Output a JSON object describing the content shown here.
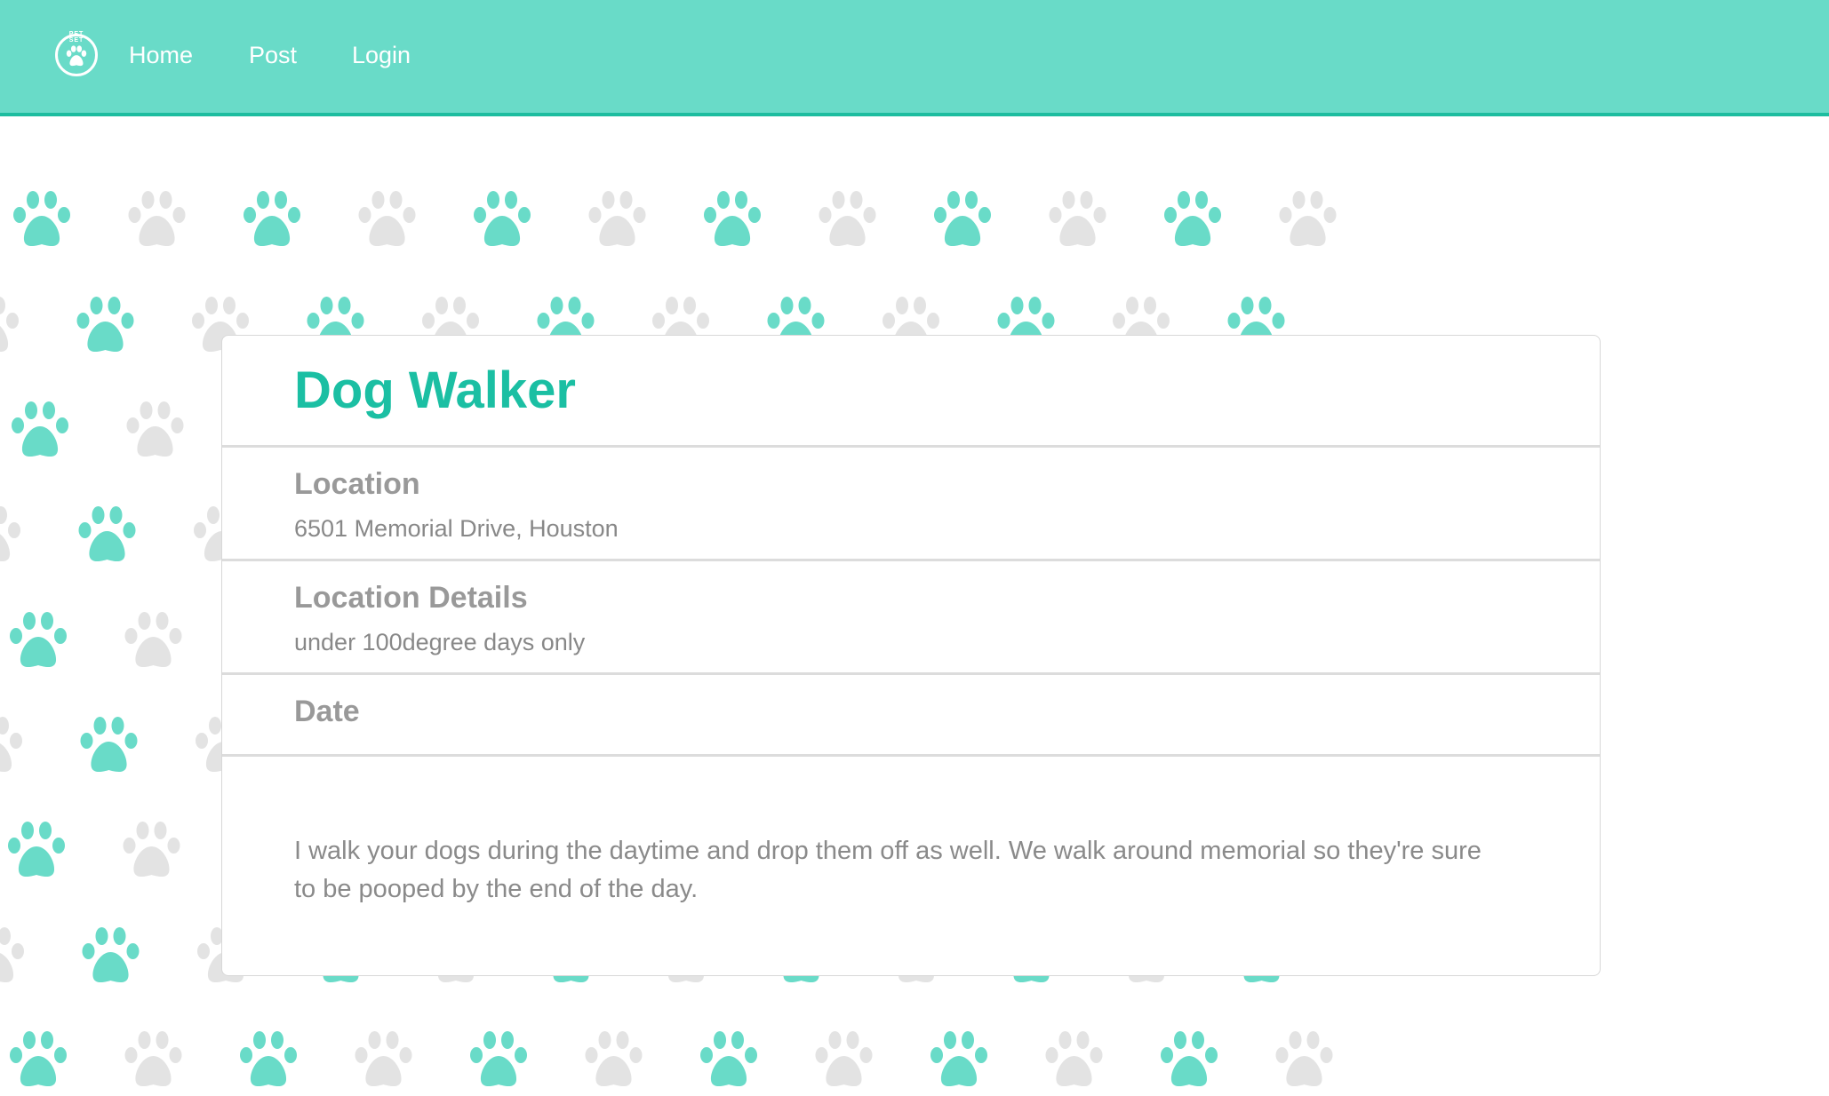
{
  "nav": {
    "logo_text": "PET SET",
    "links": [
      {
        "label": "Home"
      },
      {
        "label": "Post"
      },
      {
        "label": "Login"
      }
    ]
  },
  "colors": {
    "brand": "#69dbc8",
    "accent": "#1bbfa3",
    "paw_teal": "#69dbc8",
    "paw_gray": "#e3e3e3"
  },
  "listing": {
    "title": "Dog Walker",
    "location_label": "Location",
    "location_value": "6501 Memorial Drive, Houston",
    "details_label": "Location Details",
    "details_value": "under 100degree days only",
    "date_label": "Date",
    "description": "I walk your dogs during the daytime and drop them off as well. We walk around memorial so they're sure to be pooped by the end of the day."
  }
}
